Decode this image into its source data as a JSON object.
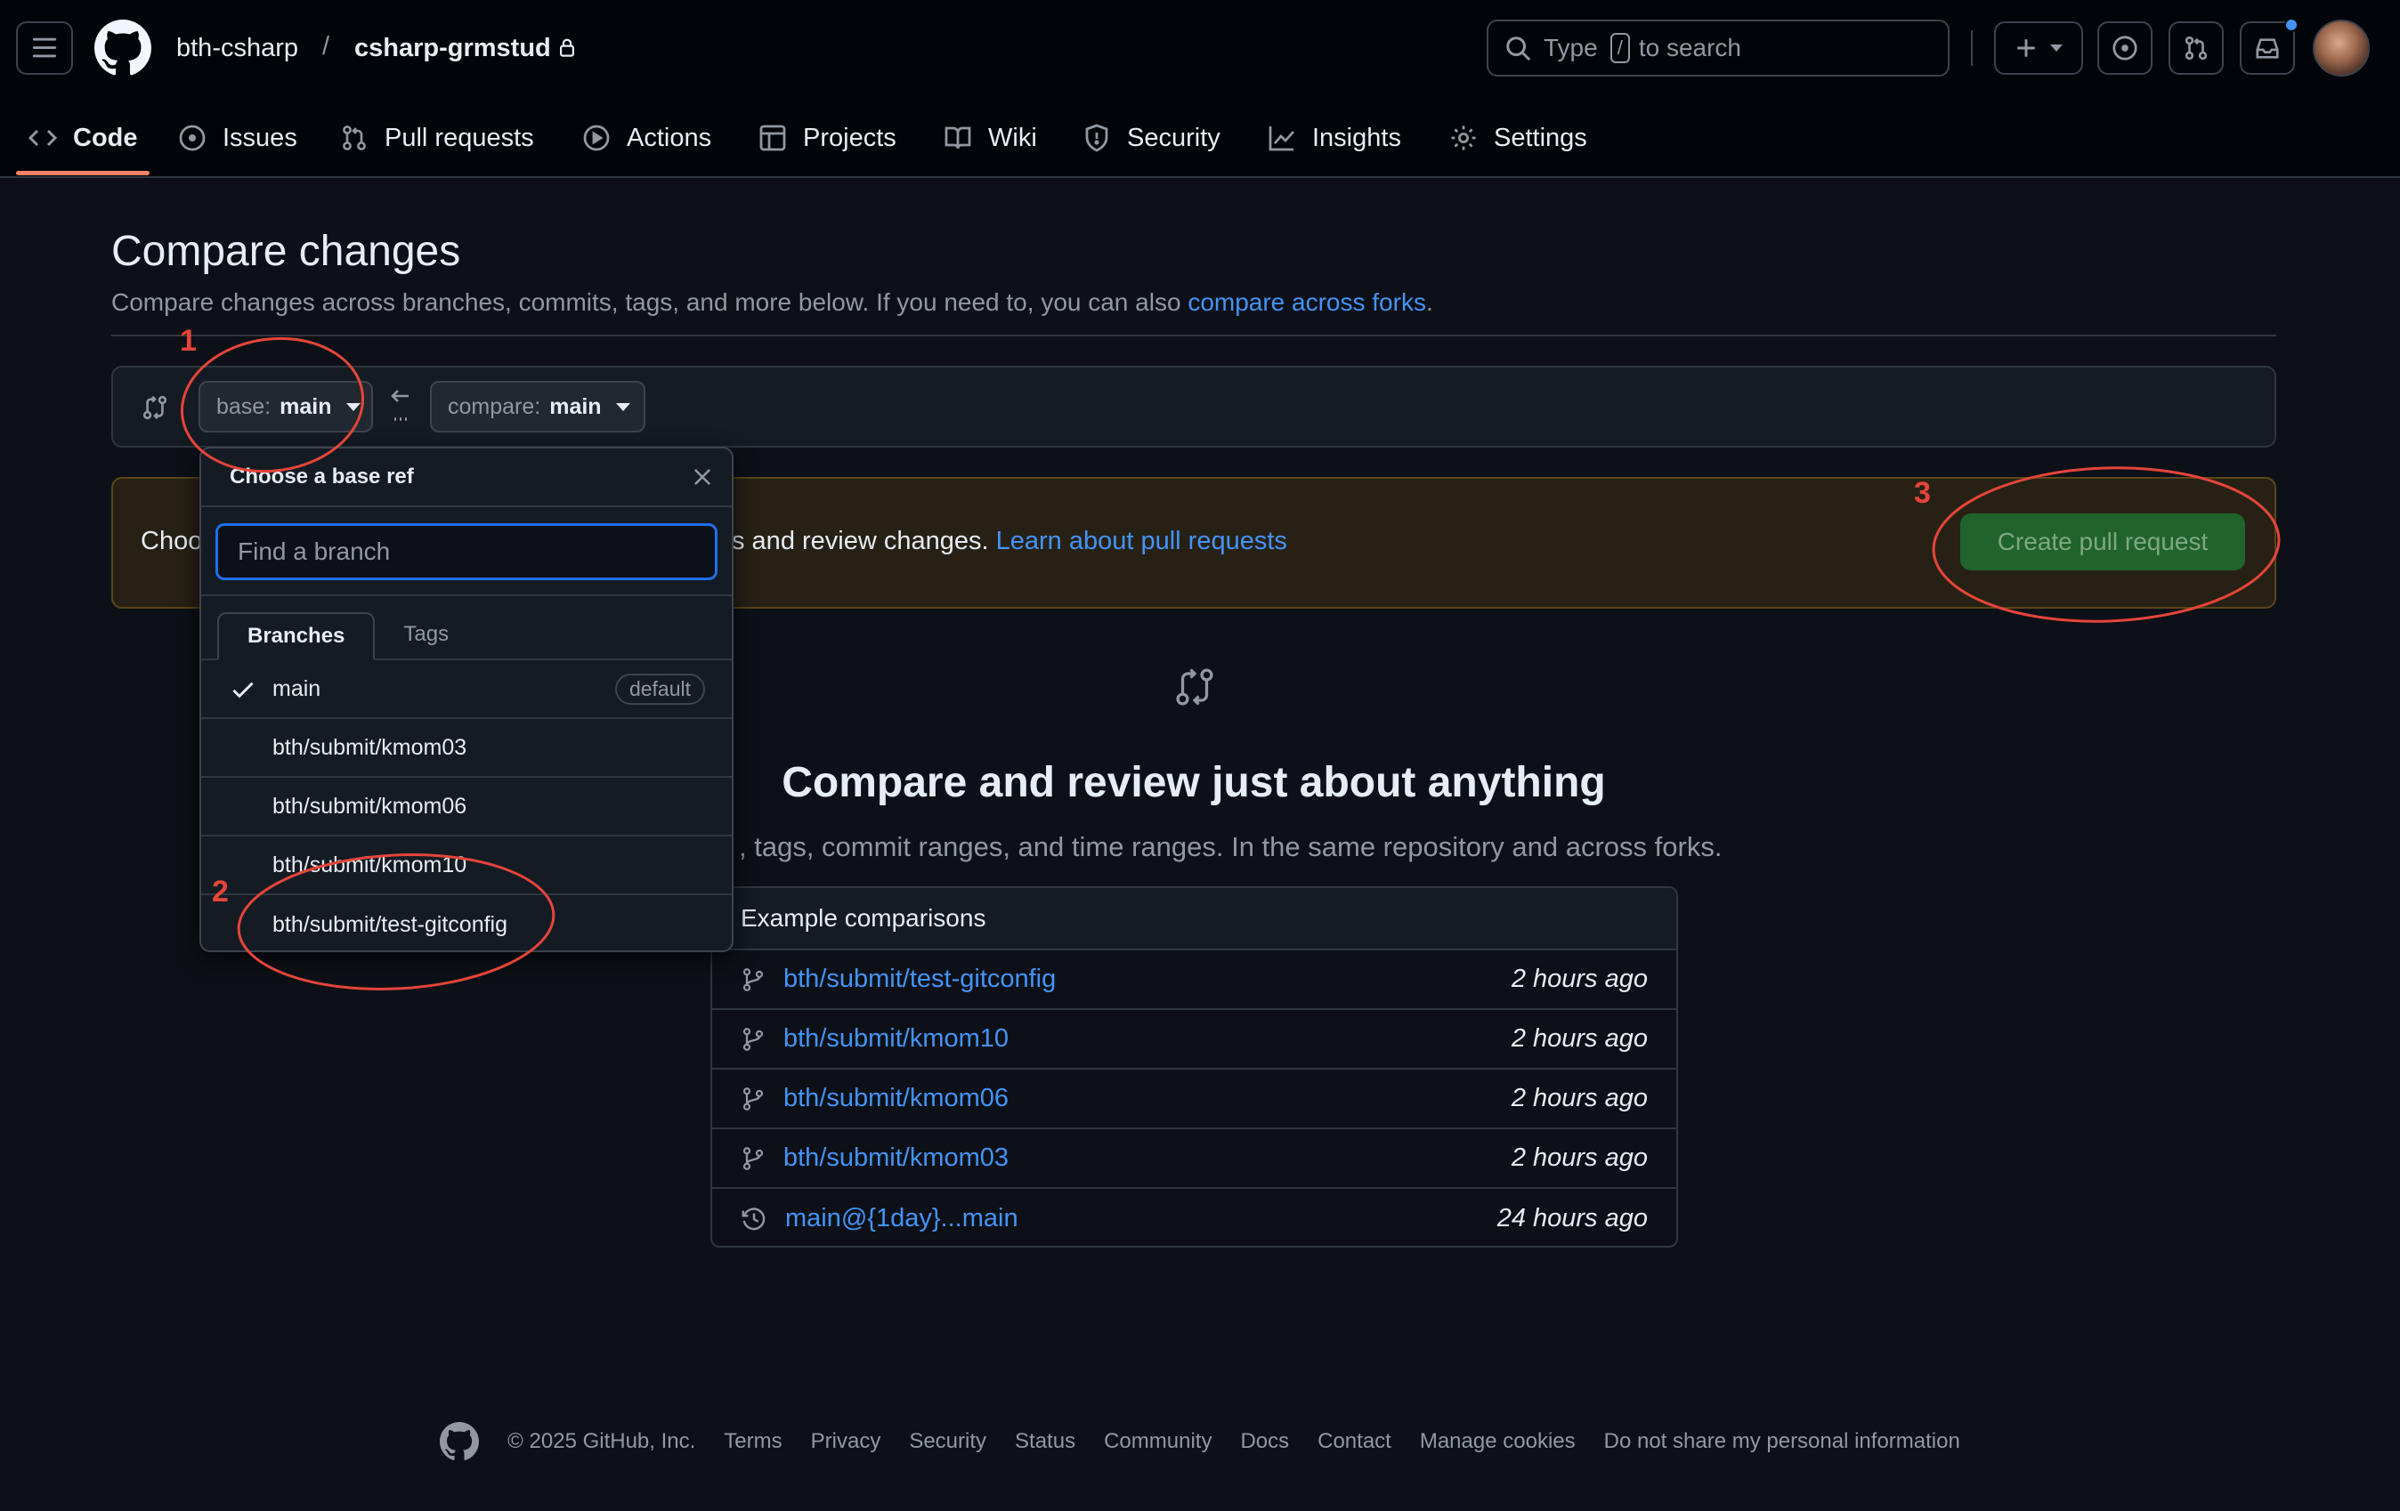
{
  "header": {
    "owner": "bth-csharp",
    "separator": "/",
    "repo": "csharp-grmstud",
    "search": {
      "pre": "Type",
      "key": "/",
      "post": "to search"
    }
  },
  "tabs": [
    {
      "label": "Code"
    },
    {
      "label": "Issues"
    },
    {
      "label": "Pull requests"
    },
    {
      "label": "Actions"
    },
    {
      "label": "Projects"
    },
    {
      "label": "Wiki"
    },
    {
      "label": "Security"
    },
    {
      "label": "Insights"
    },
    {
      "label": "Settings"
    }
  ],
  "compare": {
    "title": "Compare changes",
    "desc_prefix": "Compare changes across branches, commits, tags, and more below. If you need to, you can also ",
    "desc_link": "compare across forks",
    "desc_suffix": ".",
    "base_prefix": "base:",
    "base_value": "main",
    "compare_prefix": "compare:",
    "compare_value": "main"
  },
  "flash": {
    "text_left": "Choo",
    "text_right": "s and review changes. ",
    "link": "Learn about pull requests",
    "button": "Create pull request"
  },
  "blankslate": {
    "title": "Compare and review just about anything",
    "subtitle": ", tags, commit ranges, and time ranges. In the same repository and across forks."
  },
  "examples": {
    "heading": "Example comparisons",
    "rows": [
      {
        "icon": "branch-icon",
        "name": "bth/submit/test-gitconfig",
        "time": "2 hours ago"
      },
      {
        "icon": "branch-icon",
        "name": "bth/submit/kmom10",
        "time": "2 hours ago"
      },
      {
        "icon": "branch-icon",
        "name": "bth/submit/kmom06",
        "time": "2 hours ago"
      },
      {
        "icon": "branch-icon",
        "name": "bth/submit/kmom03",
        "time": "2 hours ago"
      },
      {
        "icon": "history-icon",
        "name": "main@{1day}...main",
        "time": "24 hours ago"
      }
    ]
  },
  "dropdown": {
    "title": "Choose a base ref",
    "filter_placeholder": "Find a branch",
    "tabs": [
      "Branches",
      "Tags"
    ],
    "items": [
      {
        "name": "main",
        "selected": true,
        "badge": "default"
      },
      {
        "name": "bth/submit/kmom03"
      },
      {
        "name": "bth/submit/kmom06"
      },
      {
        "name": "bth/submit/kmom10"
      },
      {
        "name": "bth/submit/test-gitconfig"
      }
    ]
  },
  "annotations": {
    "one": "1",
    "two": "2",
    "three": "3",
    "color": "#e5453a"
  },
  "footer": {
    "copyright": "© 2025 GitHub, Inc.",
    "links": [
      "Terms",
      "Privacy",
      "Security",
      "Status",
      "Community",
      "Docs",
      "Contact",
      "Manage cookies",
      "Do not share my personal information"
    ]
  },
  "colors": {
    "accent_link": "#4493f8",
    "background": "#0d1117",
    "header_bg": "#010409",
    "button_green": "#1f6f31",
    "tab_underline": "#f78166"
  }
}
